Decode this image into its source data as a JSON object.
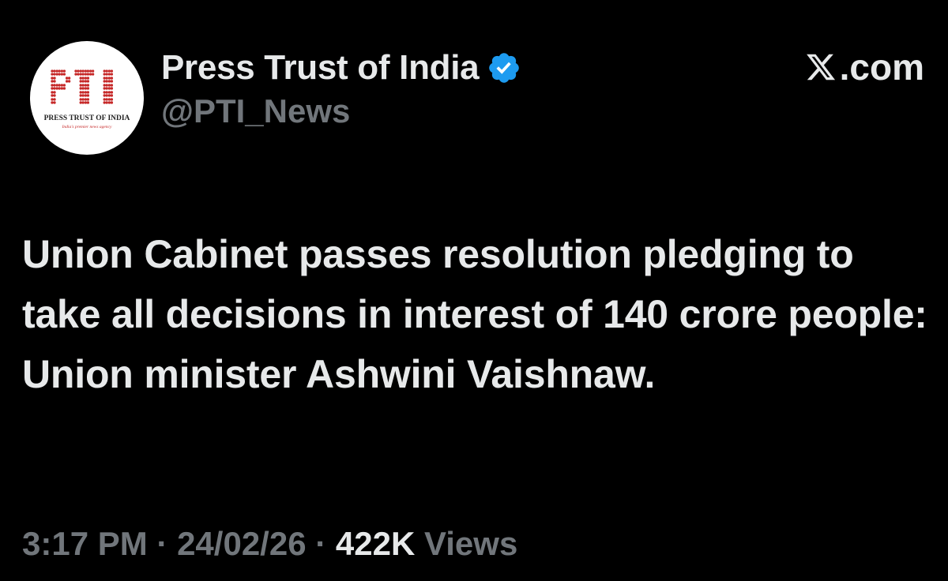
{
  "tweet": {
    "avatar": {
      "logo_text": "PTI",
      "caption": "PRESS TRUST OF INDIA",
      "tagline": "India's premier news agency"
    },
    "display_name": "Press Trust of India",
    "verified_icon": "verified-badge-icon",
    "handle": "@PTI_News",
    "site_label": ".com",
    "site_icon": "x-logo-icon",
    "body": "Union Cabinet passes resolution pledging to take all decisions in interest of 140 crore people: Union minister Ashwini Vaishnaw.",
    "time": "3:17 PM",
    "separator": "·",
    "date": "24/02/26",
    "views_count": "422K",
    "views_label": "Views"
  },
  "colors": {
    "background": "#000000",
    "primary_text": "#e7e9ea",
    "secondary_text": "#71767b",
    "verified_blue": "#1d9bf0",
    "logo_red": "#c62828"
  }
}
